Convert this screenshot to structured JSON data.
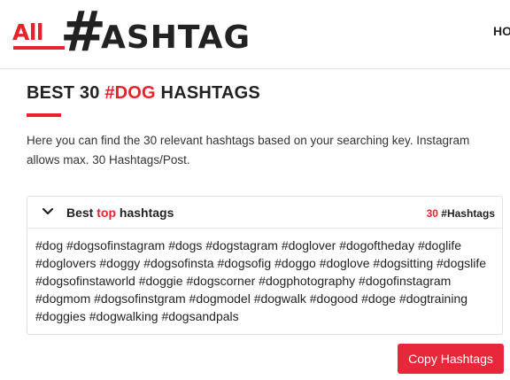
{
  "logo": {
    "all": "All",
    "hash": "#",
    "word": "ASHTAG"
  },
  "nav": {
    "home": "HO"
  },
  "page": {
    "title_prefix": "BEST 30 ",
    "title_accent": "#DOG",
    "title_suffix": " HASHTAGS",
    "intro": "Here you can find the 30 relevant hashtags based on your searching key. Instagram allows max. 30 Hashtags/Post."
  },
  "card": {
    "title_prefix": "Best ",
    "title_accent": "top",
    "title_suffix": " hashtags",
    "count_number": "30",
    "count_label": "#Hashtags",
    "hashtags": "#dog #dogsofinstagram #dogs #dogstagram #doglover #dogoftheday #doglife #doglovers #doggy #dogsofinsta #dogsofig #doggo #doglove #dogsitting #dogslife #dogsofinstaworld #doggie #dogscorner #dogphotography #dogofinstagram #dogmom #dogsofinstgram #dogmodel #dogwalk #dogood #doge #dogtraining #doggies #dogwalking #dogsandpals"
  },
  "actions": {
    "copy_label": "Copy Hashtags"
  },
  "colors": {
    "accent": "#e8222c",
    "button": "#e8283a",
    "text": "#222222"
  },
  "icons": {
    "collapse": "chevron-down-icon"
  }
}
